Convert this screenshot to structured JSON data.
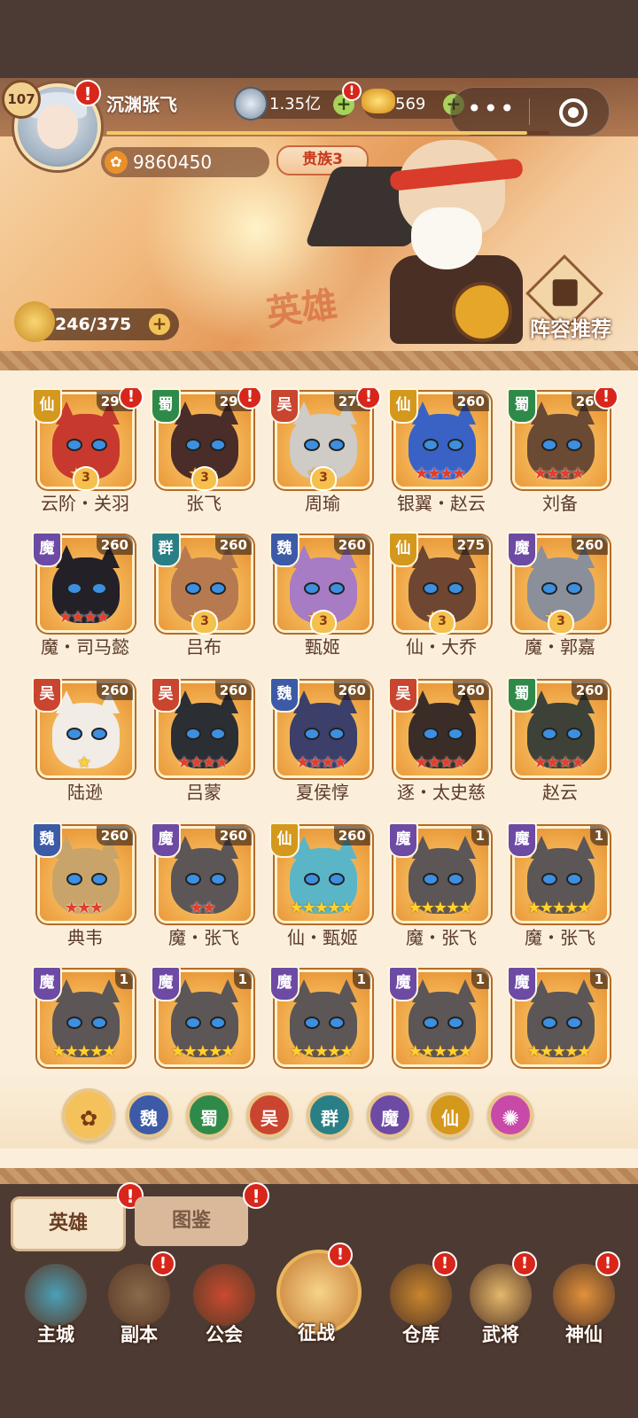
{
  "player": {
    "level": "107",
    "name": "沉渊张飞",
    "xp_fraction": 0.95,
    "power": "9860450",
    "noble_rank": "贵族3"
  },
  "resources": {
    "silver": "1.35亿",
    "gold": "569"
  },
  "banner": {
    "title_ideogram": "英雄",
    "recommend_label": "阵容推荐",
    "hero_count": "246/375"
  },
  "icons": {
    "alert": "exclamation-icon",
    "menu": "more-dots-icon",
    "close": "target-circle-icon"
  },
  "colors": {
    "wei": "#3c5aa6",
    "shu": "#2f8a4a",
    "wu": "#c9452f",
    "qun": "#2a7f86",
    "mo": "#6d4aa3",
    "xian": "#d3981c",
    "alert": "#d8261b"
  },
  "heroes": [
    {
      "name": "云阶・关羽",
      "faction": "仙",
      "faction_key": "xian",
      "level": "290",
      "alert": true,
      "stars_type": "crest",
      "stars": 3,
      "crest": "3",
      "theme": "#c7392e"
    },
    {
      "name": "张飞",
      "faction": "蜀",
      "faction_key": "shu",
      "level": "290",
      "alert": true,
      "stars_type": "crest",
      "stars": 3,
      "crest": "3",
      "theme": "#4a2c28"
    },
    {
      "name": "周瑜",
      "faction": "吴",
      "faction_key": "wu",
      "level": "273",
      "alert": true,
      "stars_type": "crest",
      "stars": 3,
      "crest": "3",
      "theme": "#cfcbc6"
    },
    {
      "name": "银翼・赵云",
      "faction": "仙",
      "faction_key": "xian",
      "level": "260",
      "alert": false,
      "stars_type": "red",
      "stars": 4,
      "crest": "",
      "theme": "#3a62c4"
    },
    {
      "name": "刘备",
      "faction": "蜀",
      "faction_key": "shu",
      "level": "260",
      "alert": true,
      "stars_type": "red",
      "stars": 4,
      "crest": "",
      "theme": "#6b4a34"
    },
    {
      "name": "魔・司马懿",
      "faction": "魔",
      "faction_key": "mo",
      "level": "260",
      "alert": false,
      "stars_type": "red",
      "stars": 4,
      "crest": "",
      "theme": "#232028"
    },
    {
      "name": "吕布",
      "faction": "群",
      "faction_key": "qun",
      "level": "260",
      "alert": false,
      "stars_type": "crest",
      "stars": 3,
      "crest": "3",
      "theme": "#b77a50"
    },
    {
      "name": "甄姬",
      "faction": "魏",
      "faction_key": "wei",
      "level": "260",
      "alert": false,
      "stars_type": "crest",
      "stars": 3,
      "crest": "3",
      "theme": "#a77cc4"
    },
    {
      "name": "仙・大乔",
      "faction": "仙",
      "faction_key": "xian",
      "level": "275",
      "alert": false,
      "stars_type": "crest",
      "stars": 3,
      "crest": "3",
      "theme": "#6e4632"
    },
    {
      "name": "魔・郭嘉",
      "faction": "魔",
      "faction_key": "mo",
      "level": "260",
      "alert": false,
      "stars_type": "crest",
      "stars": 3,
      "crest": "3",
      "theme": "#8a8f9a"
    },
    {
      "name": "陆逊",
      "faction": "吴",
      "faction_key": "wu",
      "level": "260",
      "alert": false,
      "stars_type": "gold",
      "stars": 1,
      "crest": "",
      "theme": "#f1ece6"
    },
    {
      "name": "吕蒙",
      "faction": "吴",
      "faction_key": "wu",
      "level": "260",
      "alert": false,
      "stars_type": "red",
      "stars": 4,
      "crest": "",
      "theme": "#2b2e33"
    },
    {
      "name": "夏侯惇",
      "faction": "魏",
      "faction_key": "wei",
      "level": "260",
      "alert": false,
      "stars_type": "red",
      "stars": 4,
      "crest": "",
      "theme": "#3b3f6a"
    },
    {
      "name": "逐・太史慈",
      "faction": "吴",
      "faction_key": "wu",
      "level": "260",
      "alert": false,
      "stars_type": "red",
      "stars": 4,
      "crest": "",
      "theme": "#3a2d28"
    },
    {
      "name": "赵云",
      "faction": "蜀",
      "faction_key": "shu",
      "level": "260",
      "alert": false,
      "stars_type": "red",
      "stars": 4,
      "crest": "",
      "theme": "#3d4138"
    },
    {
      "name": "典韦",
      "faction": "魏",
      "faction_key": "wei",
      "level": "260",
      "alert": false,
      "stars_type": "red",
      "stars": 3,
      "crest": "",
      "theme": "#c8a46a"
    },
    {
      "name": "魔・张飞",
      "faction": "魔",
      "faction_key": "mo",
      "level": "260",
      "alert": false,
      "stars_type": "red",
      "stars": 2,
      "crest": "",
      "theme": "#5c5656"
    },
    {
      "name": "仙・甄姬",
      "faction": "仙",
      "faction_key": "xian",
      "level": "260",
      "alert": false,
      "stars_type": "gold",
      "stars": 5,
      "crest": "",
      "theme": "#5ab6c6"
    },
    {
      "name": "魔・张飞",
      "faction": "魔",
      "faction_key": "mo",
      "level": "1",
      "alert": false,
      "stars_type": "gold",
      "stars": 5,
      "crest": "",
      "theme": "#5c5656"
    },
    {
      "name": "魔・张飞",
      "faction": "魔",
      "faction_key": "mo",
      "level": "1",
      "alert": false,
      "stars_type": "gold",
      "stars": 5,
      "crest": "",
      "theme": "#5c5656"
    },
    {
      "name": "",
      "faction": "魔",
      "faction_key": "mo",
      "level": "1",
      "alert": false,
      "stars_type": "gold",
      "stars": 5,
      "crest": "",
      "theme": "#5c5656"
    },
    {
      "name": "",
      "faction": "魔",
      "faction_key": "mo",
      "level": "1",
      "alert": false,
      "stars_type": "gold",
      "stars": 5,
      "crest": "",
      "theme": "#5c5656"
    },
    {
      "name": "",
      "faction": "魔",
      "faction_key": "mo",
      "level": "1",
      "alert": false,
      "stars_type": "gold",
      "stars": 5,
      "crest": "",
      "theme": "#5c5656"
    },
    {
      "name": "",
      "faction": "魔",
      "faction_key": "mo",
      "level": "1",
      "alert": false,
      "stars_type": "gold",
      "stars": 5,
      "crest": "",
      "theme": "#5c5656"
    },
    {
      "name": "",
      "faction": "魔",
      "faction_key": "mo",
      "level": "1",
      "alert": false,
      "stars_type": "gold",
      "stars": 5,
      "crest": "",
      "theme": "#5c5656"
    }
  ],
  "filters": [
    {
      "label": "",
      "key": "all",
      "icon": "paw-icon",
      "color": "#f4c15a"
    },
    {
      "label": "魏",
      "key": "wei",
      "color": "#3c5aa6"
    },
    {
      "label": "蜀",
      "key": "shu",
      "color": "#2f8a4a"
    },
    {
      "label": "吴",
      "key": "wu",
      "color": "#c9452f"
    },
    {
      "label": "群",
      "key": "qun",
      "color": "#2a7f86"
    },
    {
      "label": "魔",
      "key": "mo",
      "color": "#6d4aa3"
    },
    {
      "label": "仙",
      "key": "xian",
      "color": "#d3981c"
    },
    {
      "label": "",
      "key": "special",
      "icon": "swirl-icon",
      "color": "#c84aa8"
    }
  ],
  "tabs": [
    {
      "label": "英雄",
      "active": true,
      "alert": true
    },
    {
      "label": "图鉴",
      "active": false,
      "alert": true
    }
  ],
  "nav": [
    {
      "label": "主城",
      "alert": false,
      "color": "#4aa0b8"
    },
    {
      "label": "副本",
      "alert": true,
      "color": "#8a6a4a"
    },
    {
      "label": "公会",
      "alert": false,
      "color": "#c94a2e"
    },
    {
      "label": "征战",
      "alert": true,
      "color": "#e0a045"
    },
    {
      "label": "仓库",
      "alert": true,
      "color": "#c8862c"
    },
    {
      "label": "武将",
      "alert": true,
      "color": "#e4b76a"
    },
    {
      "label": "神仙",
      "alert": true,
      "color": "#e2913a"
    }
  ]
}
